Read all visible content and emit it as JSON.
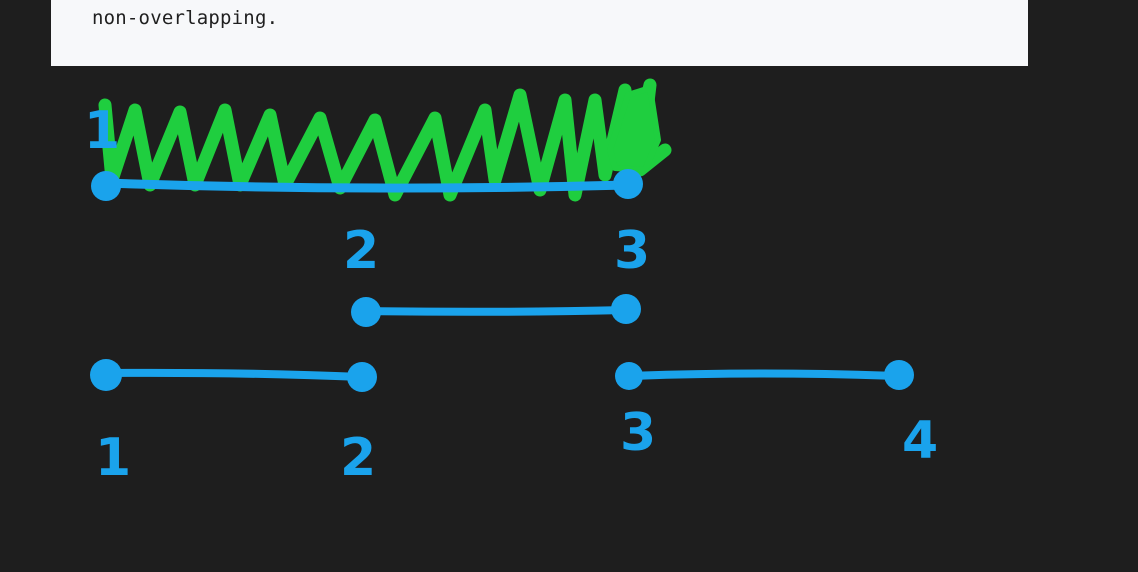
{
  "colors": {
    "background": "#1e1e1e",
    "panel": "#f7f8fa",
    "panel_text": "#1f1f1f",
    "blue_ink": "#1aa3ec",
    "green_ink": "#1fce3f"
  },
  "text_panel": {
    "line": "non-overlapping."
  },
  "drawing": {
    "merged_interval": {
      "start_label": "1",
      "mid_label": "2",
      "end_label": "3"
    },
    "middle_interval": {
      "label_above_start": "2",
      "label_above_end": "3"
    },
    "bottom_left_interval": {
      "start_label": "1",
      "end_label": "2"
    },
    "bottom_right_interval": {
      "start_label": "3",
      "end_label": "4"
    }
  }
}
